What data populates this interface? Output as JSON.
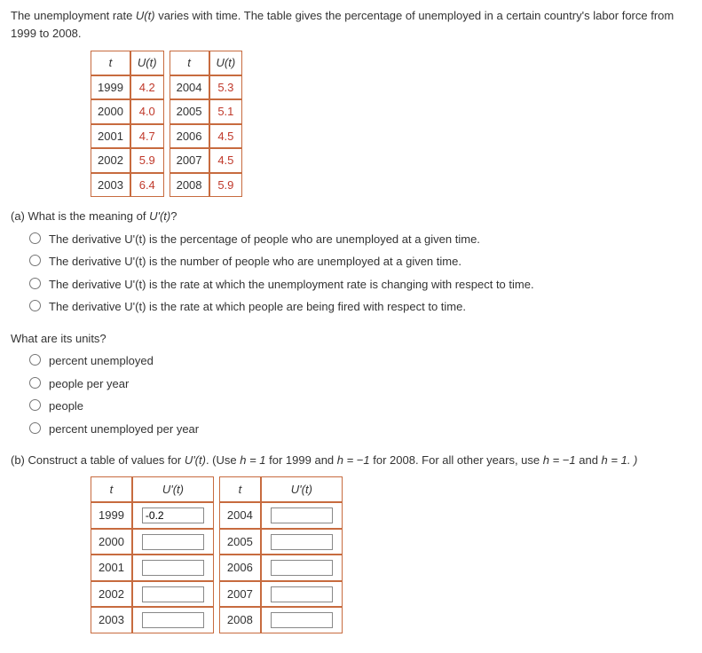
{
  "intro": {
    "line1_pre": "The unemployment rate ",
    "line1_func": "U(t)",
    "line1_post": " varies with time. The table gives the percentage of unemployed in a certain country's labor force from 1999 to 2008."
  },
  "table1": {
    "h_t": "t",
    "h_ut": "U(t)",
    "rows": [
      {
        "y1": "1999",
        "v1": "4.2",
        "y2": "2004",
        "v2": "5.3"
      },
      {
        "y1": "2000",
        "v1": "4.0",
        "y2": "2005",
        "v2": "5.1"
      },
      {
        "y1": "2001",
        "v1": "4.7",
        "y2": "2006",
        "v2": "4.5"
      },
      {
        "y1": "2002",
        "v1": "5.9",
        "y2": "2007",
        "v2": "4.5"
      },
      {
        "y1": "2003",
        "v1": "6.4",
        "y2": "2008",
        "v2": "5.9"
      }
    ]
  },
  "qa": {
    "label_pre": "(a) What is the meaning of ",
    "label_func": "U'(t)",
    "label_post": "?",
    "options": [
      "The derivative U'(t) is the percentage of people who are unemployed at a given time.",
      "The derivative U'(t) is the number of people who are unemployed at a given time.",
      "The derivative U'(t) is the rate at which the unemployment rate is changing with respect to time.",
      "The derivative U'(t) is the rate at which people are being fired with respect to time."
    ]
  },
  "units_q": {
    "label": "What are its units?",
    "options": [
      "percent unemployed",
      "people per year",
      "people",
      "percent unemployed per year"
    ]
  },
  "qb": {
    "line_pre": "(b) Construct a table of values for ",
    "func": "U'(t)",
    "line_mid1": ". (Use  ",
    "h1": "h = 1",
    "mid2": "  for 1999 and  ",
    "h2": "h = −1",
    "mid3": "  for 2008. For all other years, use  ",
    "h3": "h = −1",
    "mid4": "  and  ",
    "h4": "h = 1. )",
    "table_h_t": "t",
    "table_h_ut": "U'(t)",
    "rows": [
      {
        "y1": "1999",
        "v1": "-0.2",
        "y2": "2004",
        "v2": ""
      },
      {
        "y1": "2000",
        "v1": "",
        "y2": "2005",
        "v2": ""
      },
      {
        "y1": "2001",
        "v1": "",
        "y2": "2006",
        "v2": ""
      },
      {
        "y1": "2002",
        "v1": "",
        "y2": "2007",
        "v2": ""
      },
      {
        "y1": "2003",
        "v1": "",
        "y2": "2008",
        "v2": ""
      }
    ]
  },
  "chart_data": {
    "type": "table",
    "title": "Unemployment rate U(t) by year",
    "columns": [
      "t",
      "U(t)"
    ],
    "rows": [
      [
        1999,
        4.2
      ],
      [
        2000,
        4.0
      ],
      [
        2001,
        4.7
      ],
      [
        2002,
        5.9
      ],
      [
        2003,
        6.4
      ],
      [
        2004,
        5.3
      ],
      [
        2005,
        5.1
      ],
      [
        2006,
        4.5
      ],
      [
        2007,
        4.5
      ],
      [
        2008,
        5.9
      ]
    ]
  }
}
